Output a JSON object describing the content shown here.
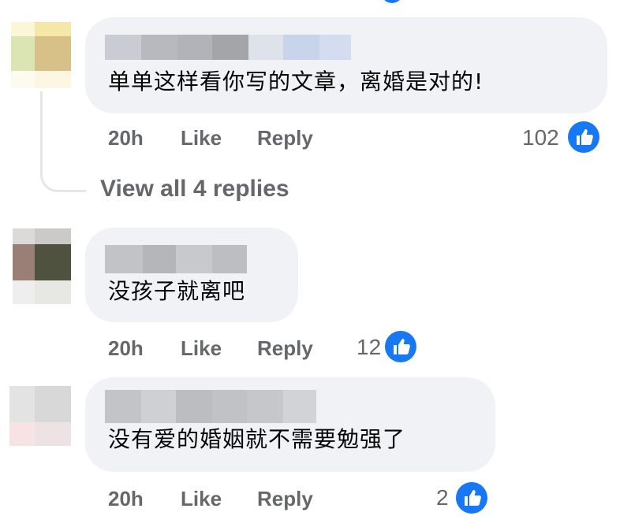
{
  "comments": [
    {
      "text": "单单这样看你写的文章，离婚是对的!",
      "time": "20h",
      "like_label": "Like",
      "reply_label": "Reply",
      "reaction_count": "102"
    },
    {
      "text": "没孩子就离吧",
      "time": "20h",
      "like_label": "Like",
      "reply_label": "Reply",
      "reaction_count": "12"
    },
    {
      "text": "没有爱的婚姻就不需要勉强了",
      "time": "20h",
      "like_label": "Like",
      "reply_label": "Reply",
      "reaction_count": "2"
    }
  ],
  "view_replies_label": "View all 4 replies",
  "icons": {
    "reaction": "thumbs-up-icon",
    "avatar": "pixelated-avatar",
    "name": "pixelated-author-name"
  },
  "colors": {
    "bubble": "#f0f2f5",
    "meta_text": "#65676b",
    "like_blue": "#1877f2"
  }
}
